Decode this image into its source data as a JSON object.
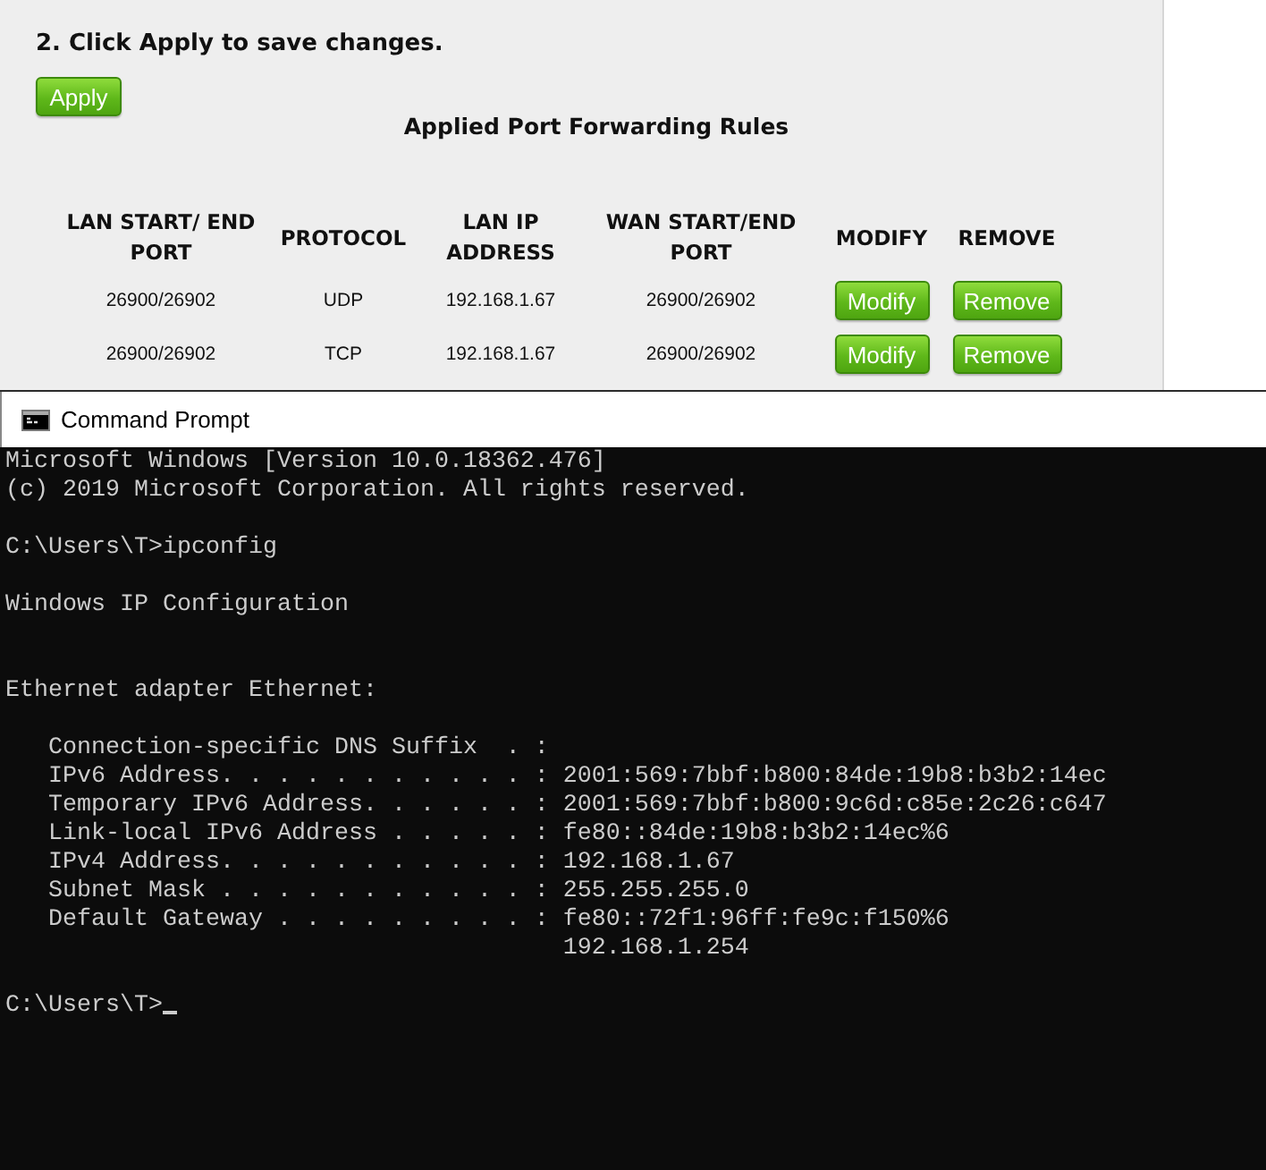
{
  "router_page": {
    "instruction": "2. Click Apply to save changes.",
    "apply_button": "Apply",
    "table": {
      "title": "Applied Port Forwarding Rules",
      "columns": [
        "LAN START/ END PORT",
        "PROTOCOL",
        "LAN IP ADDRESS",
        "WAN START/END PORT",
        "MODIFY",
        "REMOVE"
      ],
      "rows": [
        {
          "cells": [
            "26900/26902",
            "UDP",
            "192.168.1.67",
            "26900/26902"
          ],
          "actions": [
            {
              "kind": "modify",
              "label": "Modify"
            },
            {
              "kind": "remove",
              "label": "Remove"
            }
          ]
        },
        {
          "cells": [
            "26900/26902",
            "TCP",
            "192.168.1.67",
            "26900/26902"
          ],
          "actions": [
            {
              "kind": "modify",
              "label": "Modify"
            },
            {
              "kind": "remove",
              "label": "Remove"
            }
          ]
        }
      ]
    }
  },
  "console_window": {
    "title": "Command Prompt",
    "lines": [
      {
        "kind": "text",
        "text": "Microsoft Windows [Version 10.0.18362.476]"
      },
      {
        "kind": "text",
        "text": "(c) 2019 Microsoft Corporation. All rights reserved."
      },
      {
        "kind": "blank"
      },
      {
        "kind": "text",
        "text": "C:\\Users\\T>ipconfig"
      },
      {
        "kind": "blank"
      },
      {
        "kind": "text",
        "text": "Windows IP Configuration"
      },
      {
        "kind": "blank"
      },
      {
        "kind": "blank"
      },
      {
        "kind": "text",
        "text": "Ethernet adapter Ethernet:"
      },
      {
        "kind": "blank"
      },
      {
        "kind": "text",
        "text": "   Connection-specific DNS Suffix  . :"
      },
      {
        "kind": "text",
        "text": "   IPv6 Address. . . . . . . . . . . : 2001:569:7bbf:b800:84de:19b8:b3b2:14ec"
      },
      {
        "kind": "text",
        "text": "   Temporary IPv6 Address. . . . . . : 2001:569:7bbf:b800:9c6d:c85e:2c26:c647"
      },
      {
        "kind": "text",
        "text": "   Link-local IPv6 Address . . . . . : fe80::84de:19b8:b3b2:14ec%6"
      },
      {
        "kind": "text",
        "text": "   IPv4 Address. . . . . . . . . . . : 192.168.1.67"
      },
      {
        "kind": "text",
        "text": "   Subnet Mask . . . . . . . . . . . : 255.255.255.0"
      },
      {
        "kind": "text",
        "text": "   Default Gateway . . . . . . . . . : fe80::72f1:96ff:fe9c:f150%6"
      },
      {
        "kind": "text",
        "text": "                                       192.168.1.254"
      },
      {
        "kind": "blank"
      },
      {
        "kind": "prompt",
        "text": "C:\\Users\\T>",
        "cursor": true
      }
    ]
  }
}
